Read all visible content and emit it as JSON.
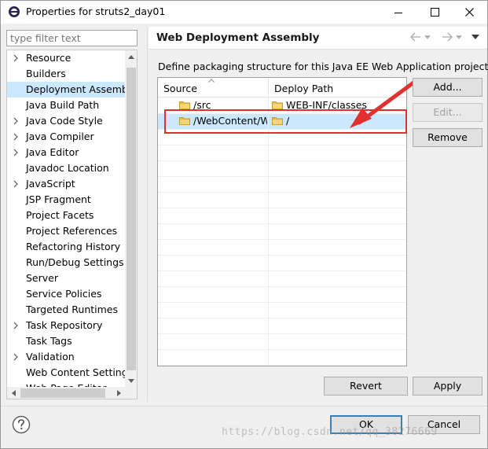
{
  "window": {
    "title": "Properties for struts2_day01",
    "icon": "eclipse-icon"
  },
  "filter": {
    "placeholder": "type filter text"
  },
  "tree": {
    "items": [
      {
        "label": "Resource",
        "expandable": true
      },
      {
        "label": "Builders",
        "expandable": false
      },
      {
        "label": "Deployment Assembly",
        "expandable": false,
        "selected": true
      },
      {
        "label": "Java Build Path",
        "expandable": false
      },
      {
        "label": "Java Code Style",
        "expandable": true
      },
      {
        "label": "Java Compiler",
        "expandable": true
      },
      {
        "label": "Java Editor",
        "expandable": true
      },
      {
        "label": "Javadoc Location",
        "expandable": false
      },
      {
        "label": "JavaScript",
        "expandable": true
      },
      {
        "label": "JSP Fragment",
        "expandable": false
      },
      {
        "label": "Project Facets",
        "expandable": false
      },
      {
        "label": "Project References",
        "expandable": false
      },
      {
        "label": "Refactoring History",
        "expandable": false
      },
      {
        "label": "Run/Debug Settings",
        "expandable": false
      },
      {
        "label": "Server",
        "expandable": false
      },
      {
        "label": "Service Policies",
        "expandable": false
      },
      {
        "label": "Targeted Runtimes",
        "expandable": false
      },
      {
        "label": "Task Repository",
        "expandable": true
      },
      {
        "label": "Task Tags",
        "expandable": false
      },
      {
        "label": "Validation",
        "expandable": true
      },
      {
        "label": "Web Content Settings",
        "expandable": false
      },
      {
        "label": "Web Page Editor",
        "expandable": false
      }
    ]
  },
  "page": {
    "title": "Web Deployment Assembly",
    "description": "Define packaging structure for this Java EE Web Application project."
  },
  "table": {
    "columns": [
      "Source",
      "Deploy Path"
    ],
    "rows": [
      {
        "source": "/src",
        "deploy": "WEB-INF/classes",
        "selected": false
      },
      {
        "source": "/WebContent/W",
        "deploy": "/",
        "selected": true
      }
    ]
  },
  "buttons": {
    "add": "Add...",
    "edit": "Edit...",
    "remove": "Remove",
    "revert": "Revert",
    "apply": "Apply",
    "ok": "OK",
    "cancel": "Cancel"
  },
  "watermark": "https://blog.csdn.net/qq_38276669",
  "colors": {
    "selection": "#cce8ff",
    "annotation": "#e0302f",
    "folder": "#e9b949"
  }
}
